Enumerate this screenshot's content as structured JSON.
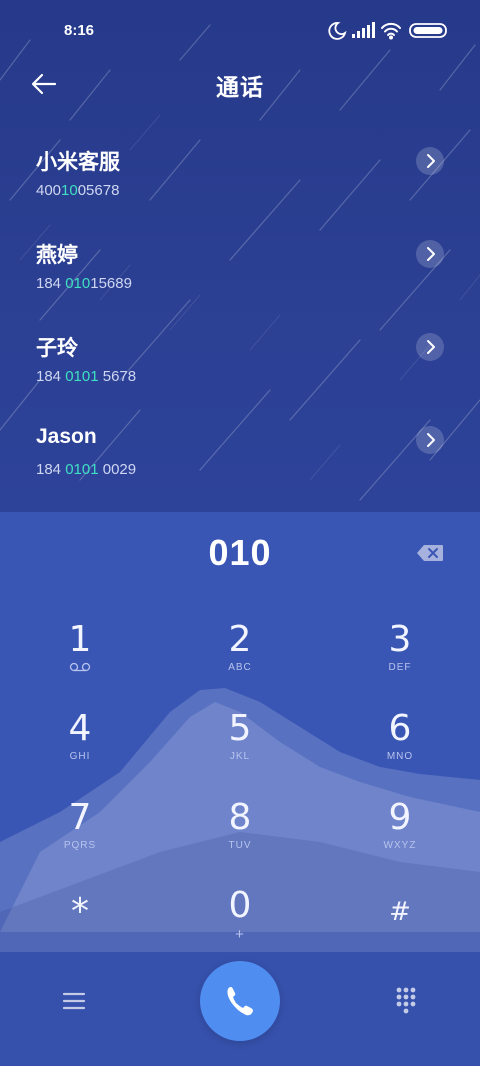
{
  "status_bar": {
    "time": "8:16",
    "icons": [
      "moon-icon",
      "signal-icon",
      "wifi-icon",
      "battery-icon"
    ]
  },
  "header": {
    "title": "通话",
    "back_icon": "back-arrow-icon"
  },
  "contacts": [
    {
      "name": "小米客服",
      "number_pre": "400",
      "number_match": "10",
      "number_post": "05678"
    },
    {
      "name": "燕婷",
      "number_pre": "184 ",
      "number_match": "010",
      "number_post": "15689"
    },
    {
      "name": "子玲",
      "number_pre": "184 ",
      "number_match": "0101",
      "number_post": " 5678"
    },
    {
      "name": "Jason",
      "number_pre": "184 ",
      "number_match": "0101",
      "number_post": " 0029"
    }
  ],
  "dialer": {
    "entry": "010",
    "keys": [
      {
        "digit": "1",
        "sub": ""
      },
      {
        "digit": "2",
        "sub": "ABC"
      },
      {
        "digit": "3",
        "sub": "DEF"
      },
      {
        "digit": "4",
        "sub": "GHI"
      },
      {
        "digit": "5",
        "sub": "JKL"
      },
      {
        "digit": "6",
        "sub": "MNO"
      },
      {
        "digit": "7",
        "sub": "PQRS"
      },
      {
        "digit": "8",
        "sub": "TUV"
      },
      {
        "digit": "9",
        "sub": "WXYZ"
      },
      {
        "digit": "*",
        "sub": ""
      },
      {
        "digit": "0",
        "sub": "+"
      },
      {
        "digit": "#",
        "sub": ""
      }
    ]
  },
  "colors": {
    "accent_match": "#3fe0c2",
    "call_button": "#4f8df0",
    "dialer_bg": "#3a56b4",
    "top_bg": "#2b3f92"
  }
}
